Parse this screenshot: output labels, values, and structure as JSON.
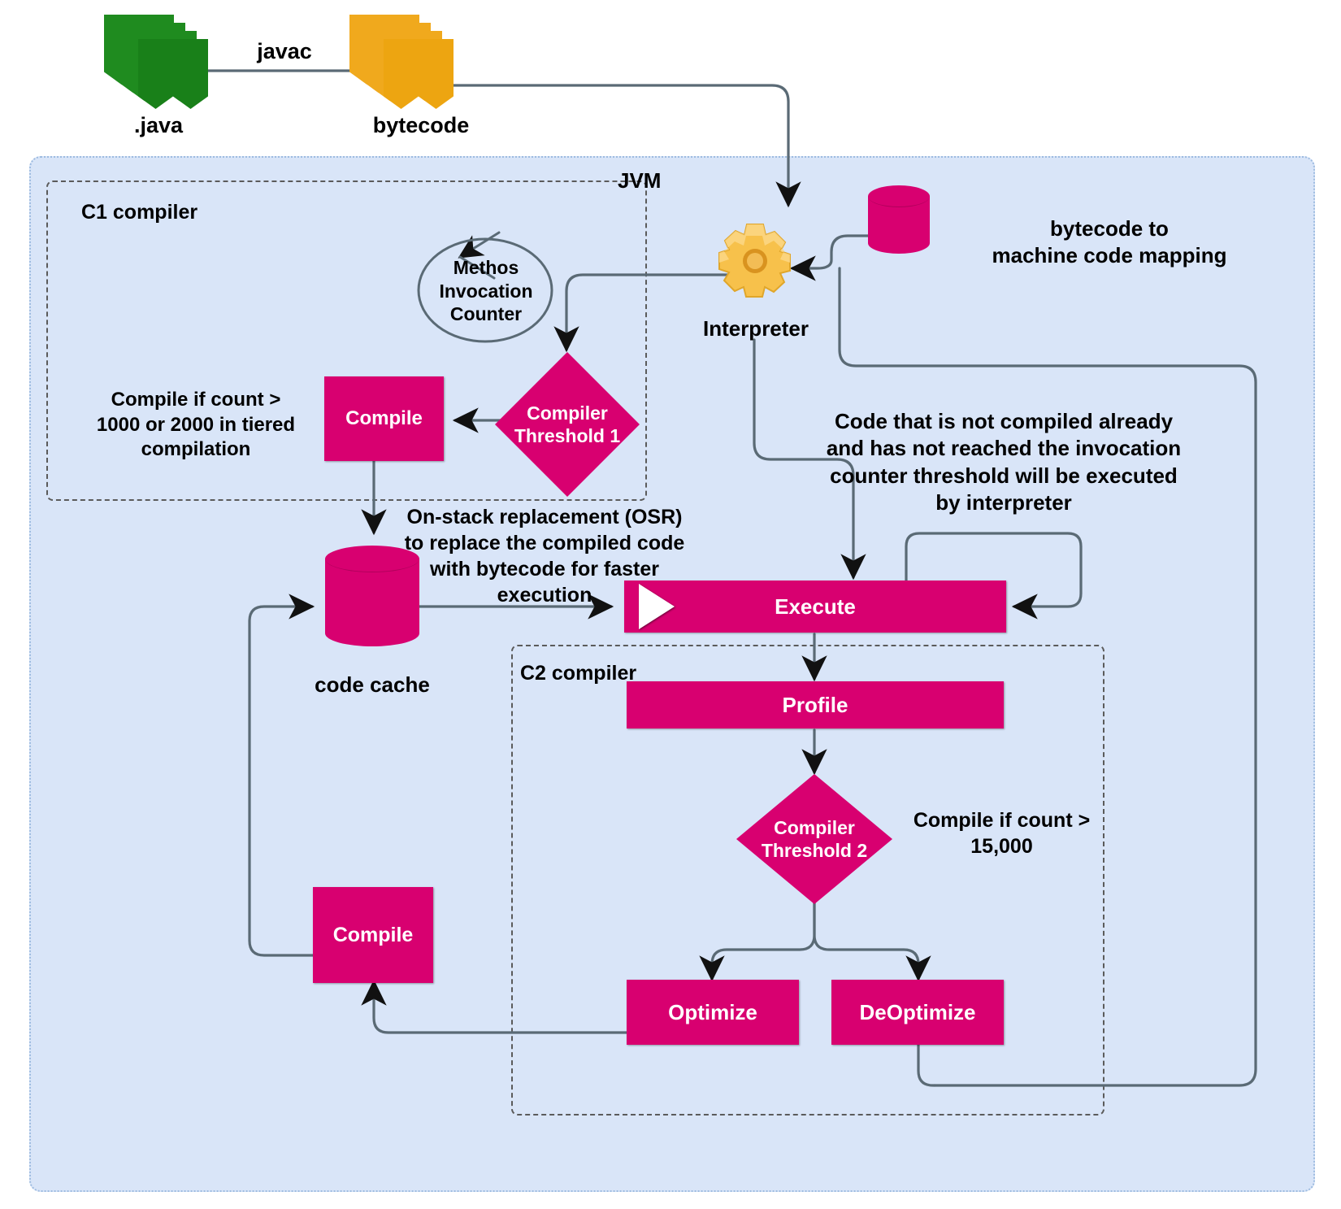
{
  "diagram": {
    "title": "JVM JIT compilation flow",
    "colors": {
      "accent": "#d80070",
      "panel": "#d9e5f8",
      "source": "#1a8a1a",
      "bytecode": "#f2a51a",
      "wire": "#5a6a75"
    }
  },
  "top_flow": {
    "source_label": ".java",
    "edge_label": "javac",
    "bytecode_label": "bytecode"
  },
  "containers": {
    "jvm": "JVM",
    "c1": "C1 compiler",
    "c2": "C2 compiler"
  },
  "nodes": {
    "method_counter": "Methos\nInvocation\nCounter",
    "compiler_threshold_1": "Compiler\nThreshold 1",
    "compile_c1": "Compile",
    "interpreter": "Interpreter",
    "code_cache": "code cache",
    "execute": "Execute",
    "profile": "Profile",
    "compiler_threshold_2": "Compiler\nThreshold 2",
    "optimize": "Optimize",
    "deoptimize": "DeOptimize",
    "compile_c2": "Compile"
  },
  "annotations": {
    "c1_threshold": "Compile if count >\n1000 or 2000 in tiered\ncompilation",
    "mapping": "bytecode to\nmachine code mapping",
    "interpreter_note": "Code that is not compiled already\nand has not reached the invocation\ncounter threshold will be executed\nby interpreter",
    "osr": "On-stack replacement (OSR)\nto replace the compiled code\nwith bytecode for faster\nexecution",
    "c2_threshold": "Compile if count >\n15,000"
  },
  "icons": {
    "gear": "gear-icon",
    "play": "play-icon",
    "database": "database-icon",
    "documents": "documents-icon"
  }
}
